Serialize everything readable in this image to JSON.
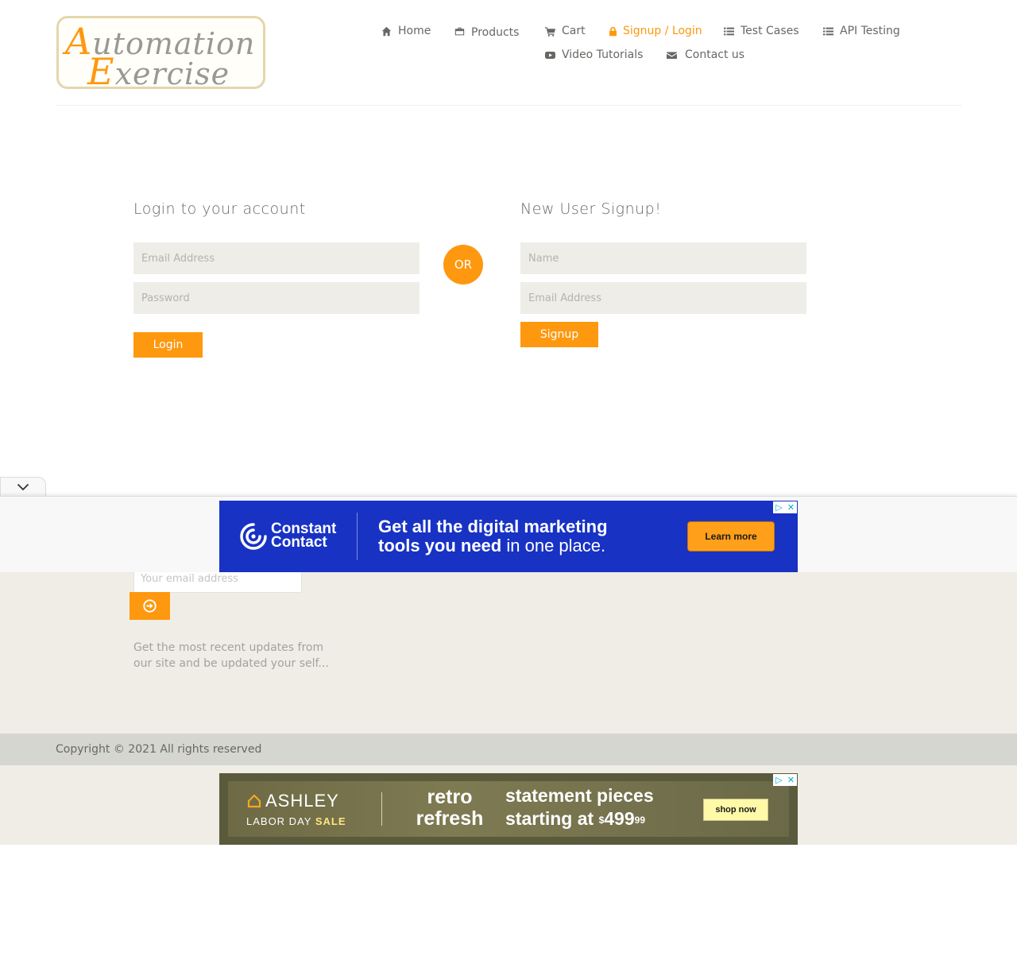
{
  "logo": {
    "line1_initial": "A",
    "line1_rest": "utomation",
    "line2_initial": "E",
    "line2_rest": "xercise"
  },
  "nav": {
    "home": "Home",
    "products": "Products",
    "cart": "Cart",
    "signup_login": "Signup / Login",
    "test_cases": "Test Cases",
    "api_testing": "API Testing",
    "video_tutorials": "Video Tutorials",
    "contact_us": "Contact us"
  },
  "login": {
    "title": "Login to your account",
    "email_placeholder": "Email Address",
    "password_placeholder": "Password",
    "button": "Login"
  },
  "or_label": "OR",
  "signup": {
    "title": "New User Signup!",
    "name_placeholder": "Name",
    "email_placeholder": "Email Address",
    "button": "Signup"
  },
  "subscription": {
    "email_placeholder": "Your email address",
    "description": "Get the most recent updates from our site and be updated your self..."
  },
  "footer": {
    "copyright": "Copyright © 2021 All rights reserved"
  },
  "ad_top": {
    "brand_line1": "Constant",
    "brand_line2": "Contact",
    "headline_line1": "Get all the digital marketing",
    "headline_line2_bold": "tools you need",
    "headline_line2_light": " in one place.",
    "cta": "Learn more"
  },
  "ad_bottom": {
    "brand": "ASHLEY",
    "sale_prefix": "LABOR DAY ",
    "sale_bold": "SALE",
    "retro_line1": "retro",
    "retro_line2": "refresh",
    "statement_line1": "statement pieces",
    "statement_line2_prefix": "starting at ",
    "price_currency": "$",
    "price_main": "499",
    "price_cents": "99",
    "cta": "shop now"
  },
  "colors": {
    "accent": "#FE980F",
    "field_bg": "#EEEDE8",
    "footer_bg": "#EFEDE6",
    "copyright_bar": "#D6D6D0",
    "ad_top_bg": "#1832C4"
  }
}
